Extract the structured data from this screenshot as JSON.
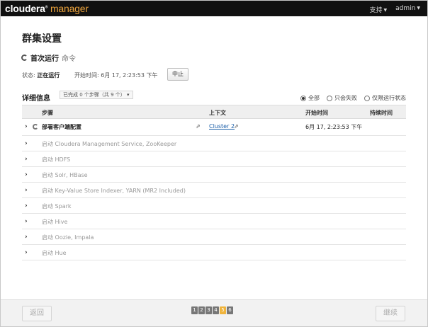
{
  "header": {
    "logo_main": "cloudera",
    "logo_sub": "manager",
    "support_label": "支持",
    "user_label": "admin"
  },
  "page": {
    "title": "群集设置"
  },
  "command": {
    "name": "首次运行",
    "label": "命令",
    "status_label": "状态:",
    "status_value": "正在运行",
    "start_label": "开始时间:",
    "start_value": "6月 17, 2:23:53 下午",
    "abort_label": "中止"
  },
  "details": {
    "title": "详细信息",
    "steps_filter": "已完成 0 个步骤（共 9 个）",
    "filter_options": [
      {
        "label": "全部",
        "selected": true
      },
      {
        "label": "只会失败",
        "selected": false
      },
      {
        "label": "仅限运行状态",
        "selected": false
      }
    ],
    "columns": {
      "step": "步骤",
      "context": "上下文",
      "start_time": "开始时间",
      "duration": "持续时间"
    },
    "first_row": {
      "step": "部署客户端配置",
      "context": "Cluster 2",
      "start_time": "6月 17, 2:23:53 下午"
    },
    "rows": [
      "启动 Cloudera Management Service, ZooKeeper",
      "启动 HDFS",
      "启动 Solr, HBase",
      "启动 Key-Value Store Indexer, YARN (MR2 Included)",
      "启动 Spark",
      "启动 Hive",
      "启动 Oozie, Impala",
      "启动 Hue"
    ]
  },
  "footer": {
    "back_label": "返回",
    "continue_label": "继续",
    "pages": [
      "1",
      "2",
      "3",
      "4",
      "5",
      "6"
    ],
    "current_page": "5"
  },
  "colors": {
    "topbar": "#111111",
    "accent": "#e9a13b",
    "link": "#1a5ea8",
    "active_page": "#f0b43c"
  }
}
